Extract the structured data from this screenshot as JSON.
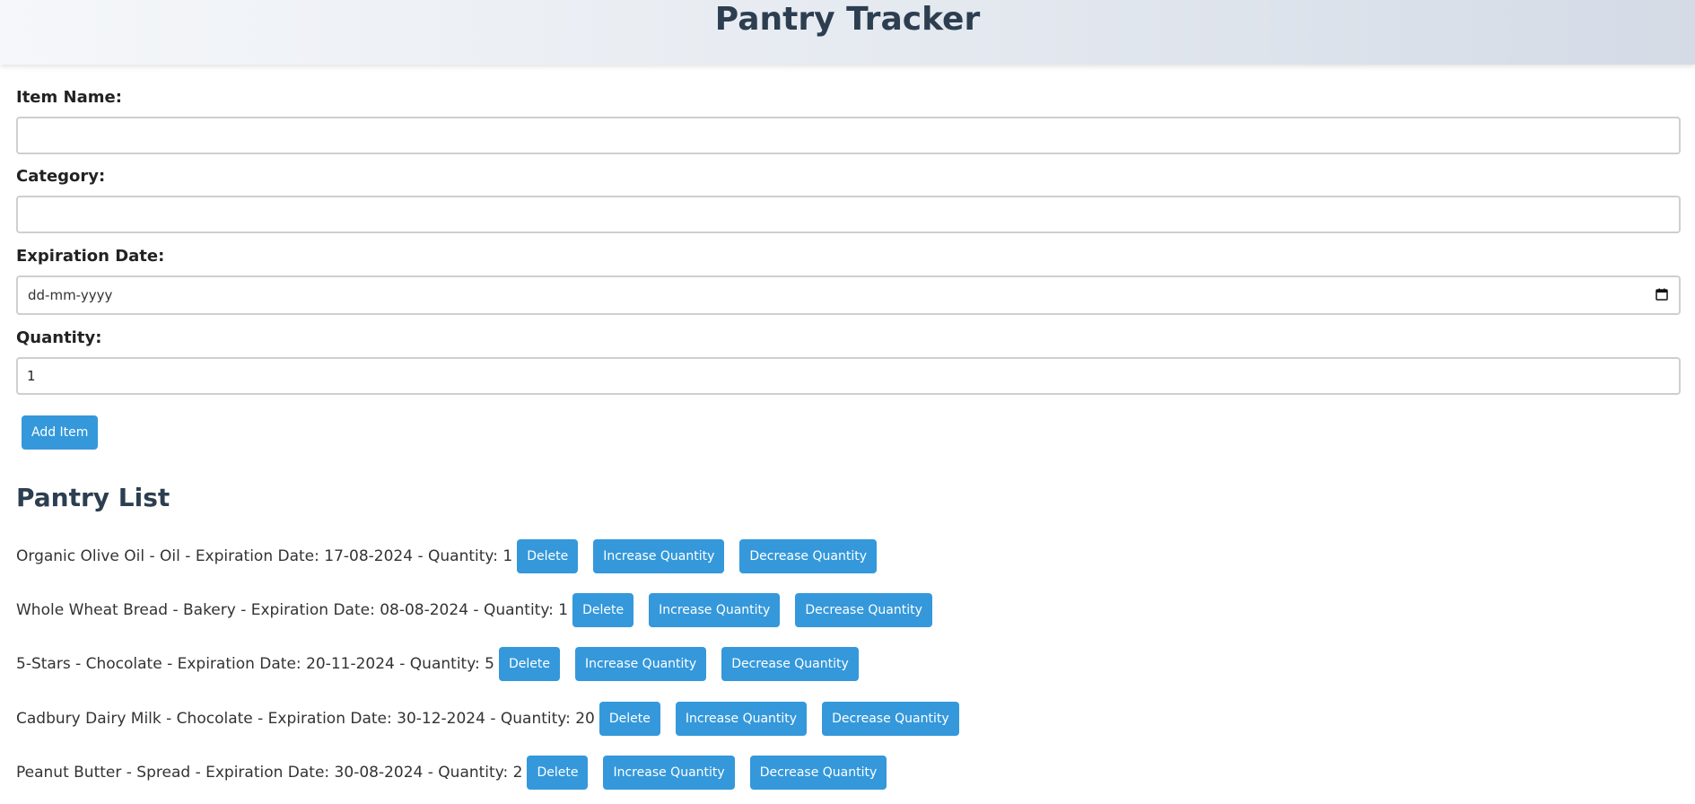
{
  "header": {
    "title": "Pantry Tracker"
  },
  "form": {
    "item_name": {
      "label": "Item Name:",
      "value": "",
      "placeholder": ""
    },
    "category": {
      "label": "Category:",
      "value": "",
      "placeholder": ""
    },
    "expiration_date": {
      "label": "Expiration Date:",
      "value": "dd-mm-yyyy"
    },
    "quantity": {
      "label": "Quantity:",
      "value": "1"
    },
    "add_button": "Add Item"
  },
  "pantry": {
    "title": "Pantry List",
    "items": [
      {
        "text": "Organic Olive Oil - Oil - Expiration Date: 17-08-2024 - Quantity: 1",
        "delete": "Delete",
        "increase": "Increase Quantity",
        "decrease": "Decrease Quantity"
      },
      {
        "text": "Whole Wheat Bread - Bakery - Expiration Date: 08-08-2024 - Quantity: 1",
        "delete": "Delete",
        "increase": "Increase Quantity",
        "decrease": "Decrease Quantity"
      },
      {
        "text": "5-Stars - Chocolate - Expiration Date: 20-11-2024 - Quantity: 5",
        "delete": "Delete",
        "increase": "Increase Quantity",
        "decrease": "Decrease Quantity"
      },
      {
        "text": "Cadbury Dairy Milk - Chocolate - Expiration Date: 30-12-2024 - Quantity: 20",
        "delete": "Delete",
        "increase": "Increase Quantity",
        "decrease": "Decrease Quantity"
      },
      {
        "text": "Peanut Butter - Spread - Expiration Date: 30-08-2024 - Quantity: 2",
        "delete": "Delete",
        "increase": "Increase Quantity",
        "decrease": "Decrease Quantity"
      }
    ]
  },
  "colors": {
    "accent": "#3498db",
    "heading": "#2c3e50"
  },
  "icons": {
    "date_picker": "calendar-icon"
  }
}
